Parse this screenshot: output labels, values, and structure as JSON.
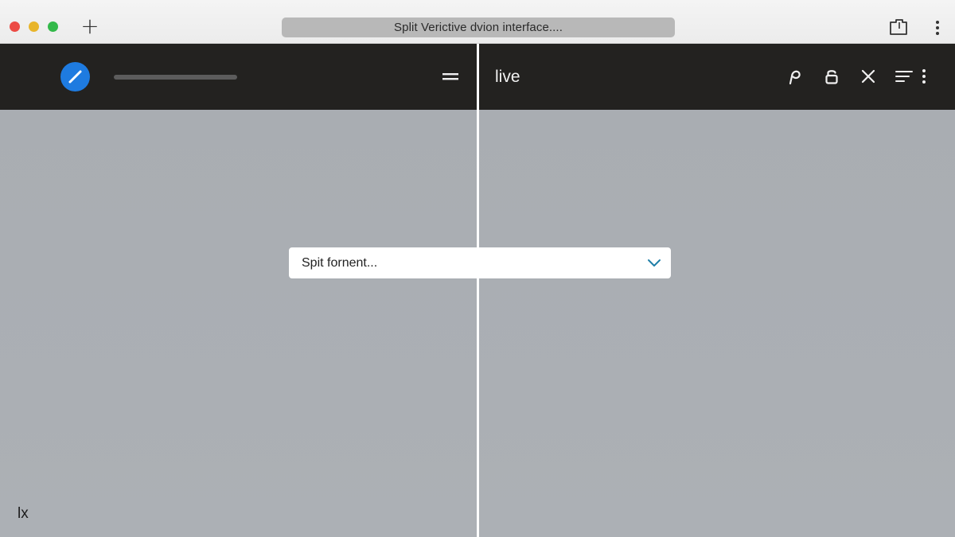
{
  "browser": {
    "address_text": "Split Verictive dvion interface....",
    "new_tab_symbol": "+",
    "icons": [
      "close-dot",
      "minimize-dot",
      "zoom-dot",
      "plus-icon",
      "share-icon",
      "kebab-menu-icon"
    ]
  },
  "app": {
    "left_pane": {
      "button_icon": "pen-icon",
      "menu_icon": "equals-icon"
    },
    "right_pane": {
      "title": "live",
      "icons": [
        "search-loop-icon",
        "lock-icon",
        "close-icon",
        "sort-icon",
        "more-vert-icon"
      ]
    }
  },
  "split_select": {
    "value": "Spit fornent...",
    "icon": "chevron-down-icon"
  },
  "corner": {
    "label": "lx"
  },
  "colors": {
    "accent": "#1e7be0",
    "appbar": "#232220",
    "content": "#aaaeb3",
    "chevron": "#1f7fa8"
  }
}
